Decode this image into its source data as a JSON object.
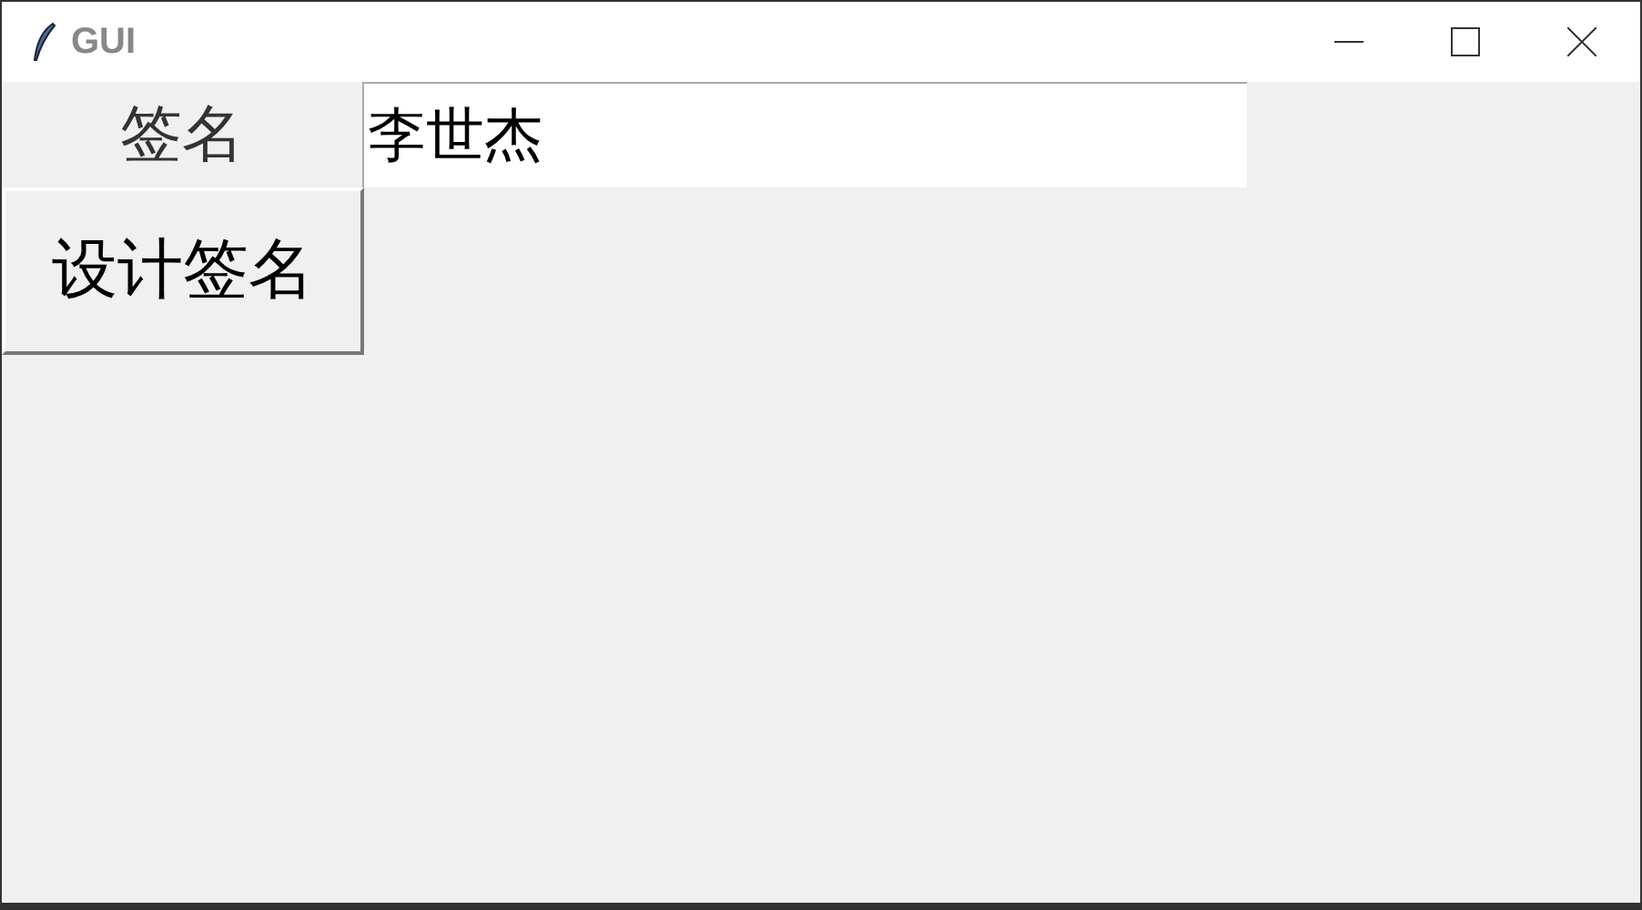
{
  "window": {
    "title": "GUI"
  },
  "form": {
    "label": "签名",
    "value": "李世杰"
  },
  "button": {
    "label": "设计签名"
  }
}
